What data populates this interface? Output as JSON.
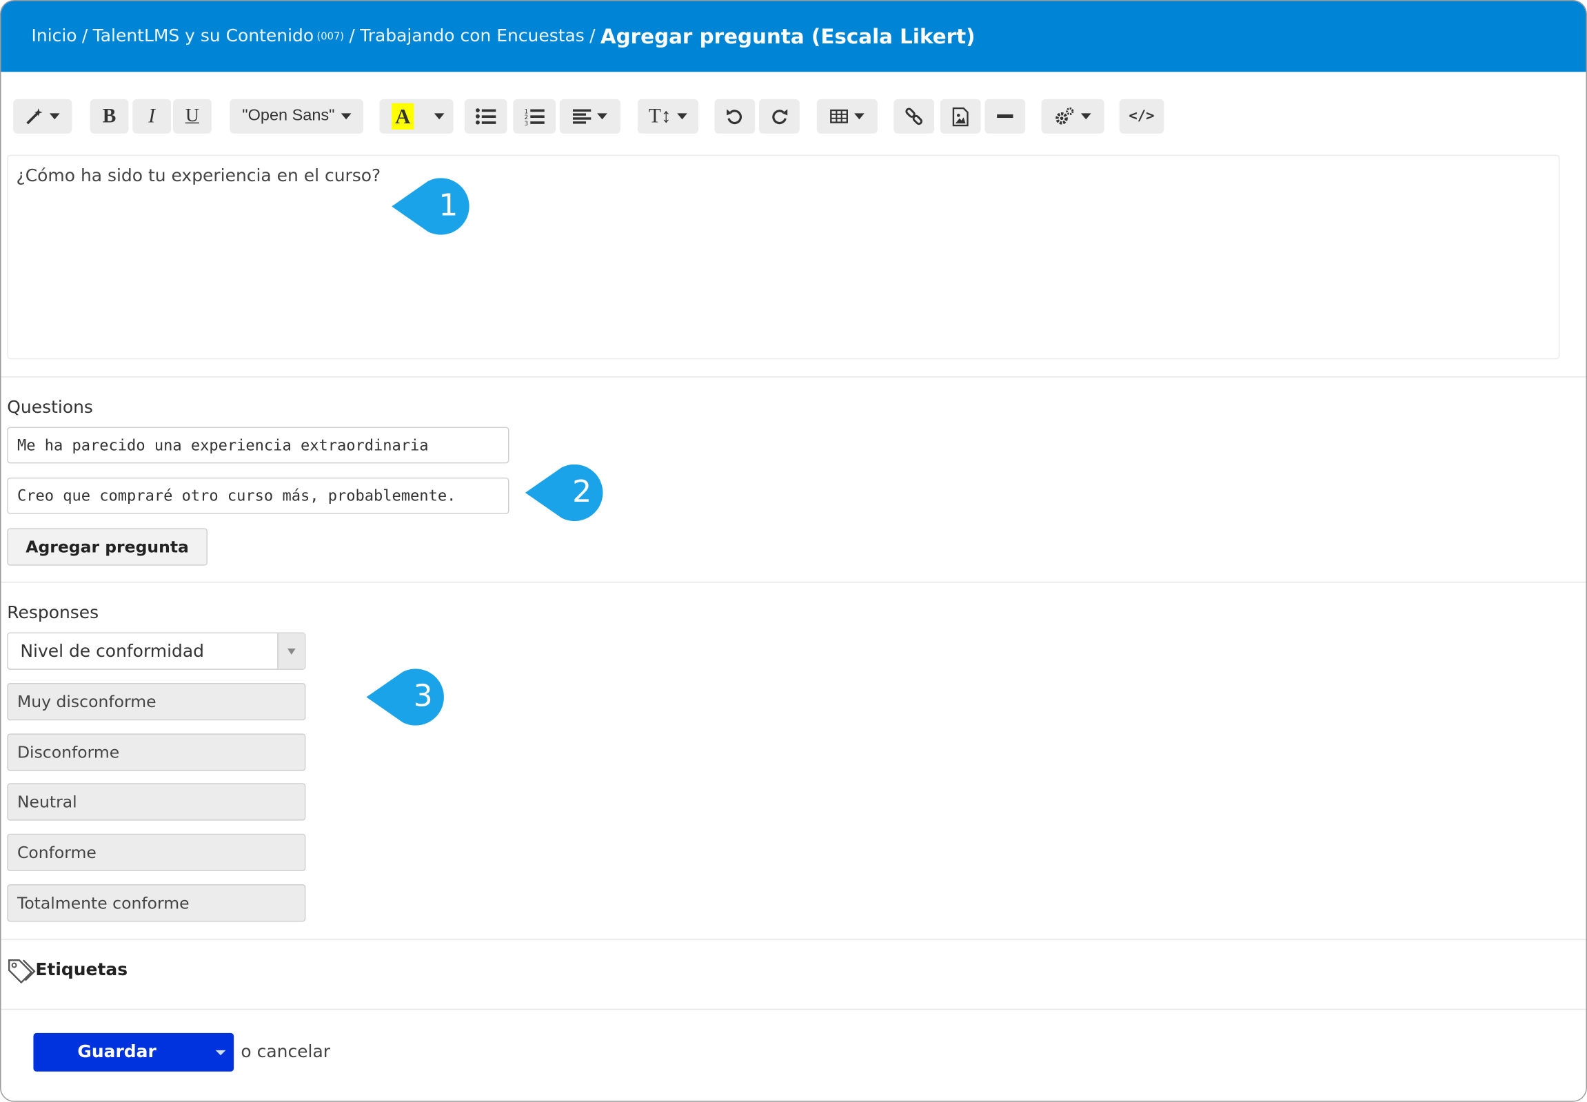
{
  "breadcrumb": {
    "items": [
      "Inicio",
      "TalentLMS y su Contenido",
      "Trabajando con Encuestas"
    ],
    "item_suffix": "(007)",
    "current": "Agregar pregunta (Escala Likert)"
  },
  "toolbar": {
    "font_name": "\"Open Sans\"",
    "highlight_color": "#ffff00",
    "buttons": [
      "magic-wand",
      "bold",
      "italic",
      "underline",
      "font-family",
      "highlight-color",
      "unordered-list",
      "ordered-list",
      "align",
      "font-size",
      "undo",
      "redo",
      "table",
      "link",
      "image",
      "horizontal-rule",
      "settings",
      "code-view"
    ]
  },
  "editor": {
    "content": "¿Cómo ha sido tu experiencia en el curso?"
  },
  "questions": {
    "label": "Questions",
    "items": [
      "Me ha parecido una experiencia extraordinaria",
      "Creo que compraré otro curso más, probablemente."
    ],
    "add_button": "Agregar pregunta"
  },
  "responses": {
    "label": "Responses",
    "selected": "Nivel de conformidad",
    "items": [
      "Muy disconforme",
      "Disconforme",
      "Neutral",
      "Conforme",
      "Totalmente conforme"
    ]
  },
  "tags": {
    "label": "Etiquetas"
  },
  "footer": {
    "save_label": "Guardar",
    "cancel_label": "o cancelar"
  },
  "callouts": [
    "1",
    "2",
    "3"
  ],
  "colors": {
    "header": "#0085d6",
    "save": "#0033dd",
    "callout": "#1aa3e8"
  }
}
